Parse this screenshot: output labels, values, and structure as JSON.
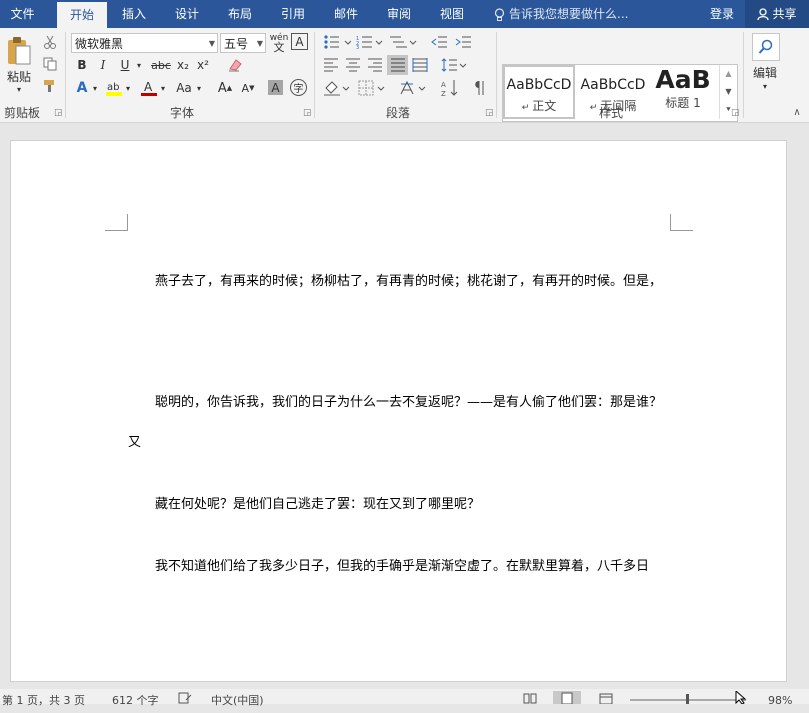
{
  "tabs": [
    "文件",
    "开始",
    "插入",
    "设计",
    "布局",
    "引用",
    "邮件",
    "审阅",
    "视图"
  ],
  "tell_me": "告诉我您想要做什么...",
  "login": "登录",
  "share": "共享",
  "clipboard": {
    "paste": "粘贴",
    "label": "剪贴板"
  },
  "font": {
    "name": "微软雅黑",
    "size": "五号",
    "label": "字体",
    "bold": "B",
    "italic": "I",
    "underline": "U",
    "strike": "abc",
    "sub": "x₂",
    "sup": "x²",
    "char_a": "A",
    "aa": "Aa",
    "grow": "A",
    "shrink": "A",
    "char_border": "A",
    "phonetic": "wén",
    "circle": "字"
  },
  "paragraph": {
    "label": "段落"
  },
  "styles": {
    "label": "样式",
    "items": [
      {
        "preview": "AaBbCcD",
        "name": "正文"
      },
      {
        "preview": "AaBbCcD",
        "name": "无间隔"
      },
      {
        "preview": "AaB",
        "name": "标题 1"
      }
    ]
  },
  "editing": {
    "label": "编辑"
  },
  "document": {
    "paragraphs": [
      "燕子去了，有再来的时候；杨柳枯了，有再青的时候；桃花谢了，有再开的时候。但是，",
      "聪明的，你告诉我，我们的日子为什么一去不复返呢？——是有人偷了他们罢：那是谁？",
      "又",
      "藏在何处呢？是他们自己逃走了罢：现在又到了哪里呢？",
      "我不知道他们给了我多少日子，但我的手确乎是渐渐空虚了。在默默里算着，八千多日"
    ]
  },
  "status": {
    "page": "第 1 页，共 3 页",
    "words": "612 个字",
    "lang": "中文(中国)",
    "zoom": "98%"
  },
  "colors": {
    "accent": "#2b579a",
    "highlight": "#ffff00",
    "font_color": "#c00000"
  }
}
